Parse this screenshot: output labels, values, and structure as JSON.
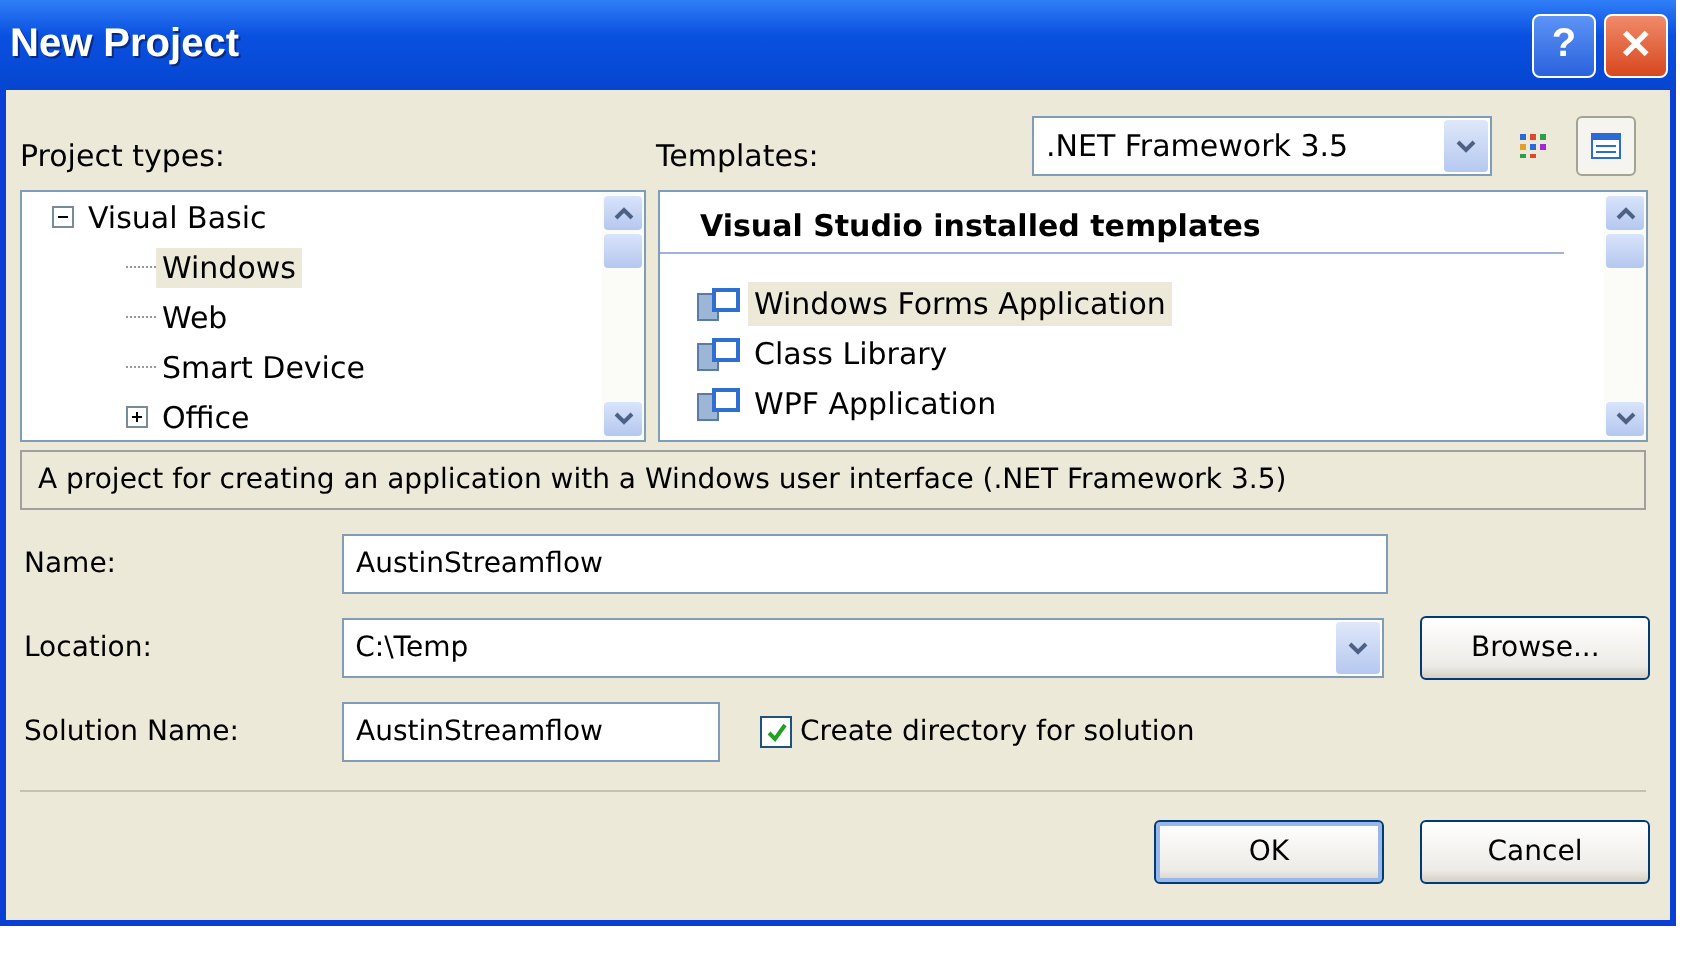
{
  "window": {
    "title": "New Project",
    "buttons": [
      {
        "kind": "help",
        "label": "?"
      },
      {
        "kind": "close",
        "label": "✕"
      }
    ]
  },
  "project_types": {
    "label": "Project types:",
    "tree": [
      {
        "label": "Visual Basic",
        "expanded": true,
        "selected": false,
        "children": [
          {
            "label": "Windows",
            "selected": true
          },
          {
            "label": "Web",
            "selected": false
          },
          {
            "label": "Smart Device",
            "selected": false
          },
          {
            "label": "Office",
            "selected": false,
            "expanded": false
          }
        ]
      }
    ]
  },
  "templates": {
    "label": "Templates:",
    "framework": ".NET Framework 3.5",
    "views": [
      {
        "kind": "large",
        "selected": false
      },
      {
        "kind": "small",
        "selected": true
      }
    ],
    "group": "Visual Studio installed templates",
    "items": [
      {
        "label": "Windows Forms Application",
        "selected": true
      },
      {
        "label": "Class Library",
        "selected": false
      },
      {
        "label": "WPF Application",
        "selected": false
      }
    ]
  },
  "description": "A project for creating an application with a Windows user interface (.NET Framework 3.5)",
  "fields": [
    {
      "label": "Name:",
      "value": "AustinStreamflow",
      "kind": "text"
    },
    {
      "label": "Location:",
      "value": "C:\\Temp",
      "kind": "combo",
      "button": "Browse..."
    },
    {
      "label": "Solution Name:",
      "value": "AustinStreamflow",
      "kind": "short",
      "checkbox": {
        "label": "Create directory for solution",
        "checked": true
      }
    }
  ],
  "buttons": [
    "OK",
    "Cancel"
  ]
}
